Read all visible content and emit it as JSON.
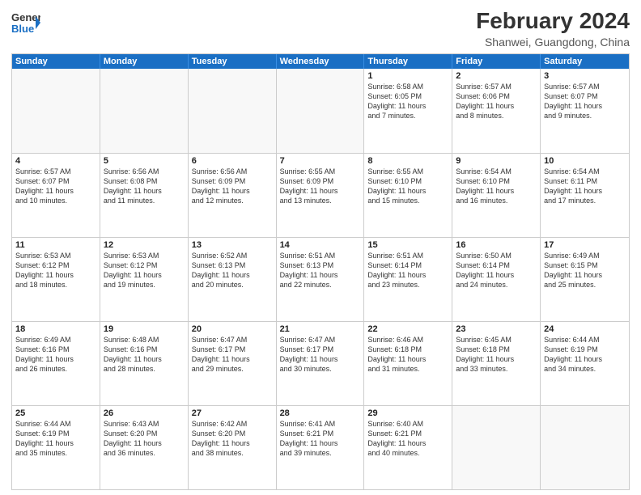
{
  "logo": {
    "line1": "General",
    "line2": "Blue",
    "icon": "▶"
  },
  "title": "February 2024",
  "location": "Shanwei, Guangdong, China",
  "header_days": [
    "Sunday",
    "Monday",
    "Tuesday",
    "Wednesday",
    "Thursday",
    "Friday",
    "Saturday"
  ],
  "weeks": [
    [
      {
        "day": "",
        "lines": []
      },
      {
        "day": "",
        "lines": []
      },
      {
        "day": "",
        "lines": []
      },
      {
        "day": "",
        "lines": []
      },
      {
        "day": "1",
        "lines": [
          "Sunrise: 6:58 AM",
          "Sunset: 6:05 PM",
          "Daylight: 11 hours",
          "and 7 minutes."
        ]
      },
      {
        "day": "2",
        "lines": [
          "Sunrise: 6:57 AM",
          "Sunset: 6:06 PM",
          "Daylight: 11 hours",
          "and 8 minutes."
        ]
      },
      {
        "day": "3",
        "lines": [
          "Sunrise: 6:57 AM",
          "Sunset: 6:07 PM",
          "Daylight: 11 hours",
          "and 9 minutes."
        ]
      }
    ],
    [
      {
        "day": "4",
        "lines": [
          "Sunrise: 6:57 AM",
          "Sunset: 6:07 PM",
          "Daylight: 11 hours",
          "and 10 minutes."
        ]
      },
      {
        "day": "5",
        "lines": [
          "Sunrise: 6:56 AM",
          "Sunset: 6:08 PM",
          "Daylight: 11 hours",
          "and 11 minutes."
        ]
      },
      {
        "day": "6",
        "lines": [
          "Sunrise: 6:56 AM",
          "Sunset: 6:09 PM",
          "Daylight: 11 hours",
          "and 12 minutes."
        ]
      },
      {
        "day": "7",
        "lines": [
          "Sunrise: 6:55 AM",
          "Sunset: 6:09 PM",
          "Daylight: 11 hours",
          "and 13 minutes."
        ]
      },
      {
        "day": "8",
        "lines": [
          "Sunrise: 6:55 AM",
          "Sunset: 6:10 PM",
          "Daylight: 11 hours",
          "and 15 minutes."
        ]
      },
      {
        "day": "9",
        "lines": [
          "Sunrise: 6:54 AM",
          "Sunset: 6:10 PM",
          "Daylight: 11 hours",
          "and 16 minutes."
        ]
      },
      {
        "day": "10",
        "lines": [
          "Sunrise: 6:54 AM",
          "Sunset: 6:11 PM",
          "Daylight: 11 hours",
          "and 17 minutes."
        ]
      }
    ],
    [
      {
        "day": "11",
        "lines": [
          "Sunrise: 6:53 AM",
          "Sunset: 6:12 PM",
          "Daylight: 11 hours",
          "and 18 minutes."
        ]
      },
      {
        "day": "12",
        "lines": [
          "Sunrise: 6:53 AM",
          "Sunset: 6:12 PM",
          "Daylight: 11 hours",
          "and 19 minutes."
        ]
      },
      {
        "day": "13",
        "lines": [
          "Sunrise: 6:52 AM",
          "Sunset: 6:13 PM",
          "Daylight: 11 hours",
          "and 20 minutes."
        ]
      },
      {
        "day": "14",
        "lines": [
          "Sunrise: 6:51 AM",
          "Sunset: 6:13 PM",
          "Daylight: 11 hours",
          "and 22 minutes."
        ]
      },
      {
        "day": "15",
        "lines": [
          "Sunrise: 6:51 AM",
          "Sunset: 6:14 PM",
          "Daylight: 11 hours",
          "and 23 minutes."
        ]
      },
      {
        "day": "16",
        "lines": [
          "Sunrise: 6:50 AM",
          "Sunset: 6:14 PM",
          "Daylight: 11 hours",
          "and 24 minutes."
        ]
      },
      {
        "day": "17",
        "lines": [
          "Sunrise: 6:49 AM",
          "Sunset: 6:15 PM",
          "Daylight: 11 hours",
          "and 25 minutes."
        ]
      }
    ],
    [
      {
        "day": "18",
        "lines": [
          "Sunrise: 6:49 AM",
          "Sunset: 6:16 PM",
          "Daylight: 11 hours",
          "and 26 minutes."
        ]
      },
      {
        "day": "19",
        "lines": [
          "Sunrise: 6:48 AM",
          "Sunset: 6:16 PM",
          "Daylight: 11 hours",
          "and 28 minutes."
        ]
      },
      {
        "day": "20",
        "lines": [
          "Sunrise: 6:47 AM",
          "Sunset: 6:17 PM",
          "Daylight: 11 hours",
          "and 29 minutes."
        ]
      },
      {
        "day": "21",
        "lines": [
          "Sunrise: 6:47 AM",
          "Sunset: 6:17 PM",
          "Daylight: 11 hours",
          "and 30 minutes."
        ]
      },
      {
        "day": "22",
        "lines": [
          "Sunrise: 6:46 AM",
          "Sunset: 6:18 PM",
          "Daylight: 11 hours",
          "and 31 minutes."
        ]
      },
      {
        "day": "23",
        "lines": [
          "Sunrise: 6:45 AM",
          "Sunset: 6:18 PM",
          "Daylight: 11 hours",
          "and 33 minutes."
        ]
      },
      {
        "day": "24",
        "lines": [
          "Sunrise: 6:44 AM",
          "Sunset: 6:19 PM",
          "Daylight: 11 hours",
          "and 34 minutes."
        ]
      }
    ],
    [
      {
        "day": "25",
        "lines": [
          "Sunrise: 6:44 AM",
          "Sunset: 6:19 PM",
          "Daylight: 11 hours",
          "and 35 minutes."
        ]
      },
      {
        "day": "26",
        "lines": [
          "Sunrise: 6:43 AM",
          "Sunset: 6:20 PM",
          "Daylight: 11 hours",
          "and 36 minutes."
        ]
      },
      {
        "day": "27",
        "lines": [
          "Sunrise: 6:42 AM",
          "Sunset: 6:20 PM",
          "Daylight: 11 hours",
          "and 38 minutes."
        ]
      },
      {
        "day": "28",
        "lines": [
          "Sunrise: 6:41 AM",
          "Sunset: 6:21 PM",
          "Daylight: 11 hours",
          "and 39 minutes."
        ]
      },
      {
        "day": "29",
        "lines": [
          "Sunrise: 6:40 AM",
          "Sunset: 6:21 PM",
          "Daylight: 11 hours",
          "and 40 minutes."
        ]
      },
      {
        "day": "",
        "lines": []
      },
      {
        "day": "",
        "lines": []
      }
    ]
  ]
}
